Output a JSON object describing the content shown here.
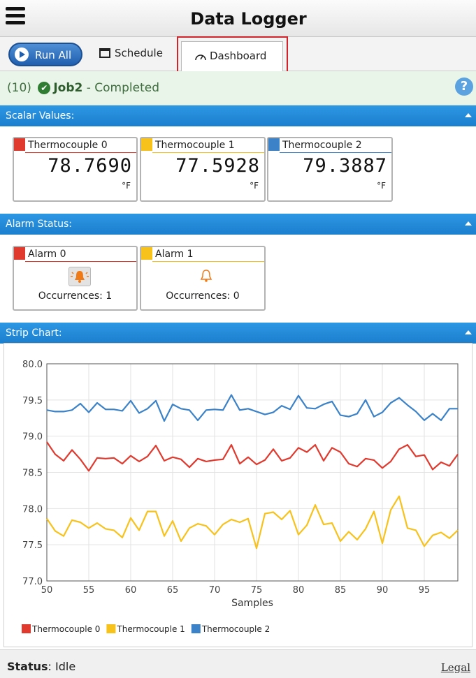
{
  "app": {
    "title": "Data Logger"
  },
  "toolbar": {
    "run_all": "Run All",
    "schedule": "Schedule",
    "dashboard": "Dashboard"
  },
  "job": {
    "count": "(10)",
    "name": "Job2",
    "status": "- Completed",
    "help": "?"
  },
  "sections": {
    "scalar": "Scalar Values:",
    "alarm": "Alarm Status:",
    "strip": "Strip Chart:"
  },
  "scalars": [
    {
      "name": "Thermocouple 0",
      "value": "78.7690",
      "unit": "°F",
      "color": "#e03a2f"
    },
    {
      "name": "Thermocouple 1",
      "value": "77.5928",
      "unit": "°F",
      "color": "#f7c21c"
    },
    {
      "name": "Thermocouple 2",
      "value": "79.3887",
      "unit": "°F",
      "color": "#3b82c8"
    }
  ],
  "alarms": [
    {
      "name": "Alarm 0",
      "occurrences": "Occurrences: 1",
      "color": "#e03a2f",
      "icon": "bell-active-icon"
    },
    {
      "name": "Alarm 1",
      "occurrences": "Occurrences: 0",
      "color": "#f7c21c",
      "icon": "bell-icon"
    }
  ],
  "chart_data": {
    "type": "line",
    "title": "",
    "xlabel": "Samples",
    "ylabel": "",
    "xlim": [
      50,
      99
    ],
    "ylim": [
      77.0,
      80.0
    ],
    "xticks": [
      "50",
      "55",
      "60",
      "65",
      "70",
      "75",
      "80",
      "85",
      "90",
      "95"
    ],
    "yticks": [
      "77.0",
      "77.5",
      "78.0",
      "78.5",
      "79.0",
      "79.5",
      "80.0"
    ],
    "grid": true,
    "legend": "bottom-left",
    "x": [
      50,
      51,
      52,
      53,
      54,
      55,
      56,
      57,
      58,
      59,
      60,
      61,
      62,
      63,
      64,
      65,
      66,
      67,
      68,
      69,
      70,
      71,
      72,
      73,
      74,
      75,
      76,
      77,
      78,
      79,
      80,
      81,
      82,
      83,
      84,
      85,
      86,
      87,
      88,
      89,
      90,
      91,
      92,
      93,
      94,
      95,
      96,
      97,
      98,
      99
    ],
    "series": [
      {
        "name": "Thermocouple 0",
        "color": "#e03a2f",
        "values": [
          78.92,
          78.75,
          78.66,
          78.81,
          78.68,
          78.52,
          78.7,
          78.69,
          78.7,
          78.62,
          78.73,
          78.65,
          78.72,
          78.87,
          78.66,
          78.71,
          78.68,
          78.57,
          78.69,
          78.65,
          78.67,
          78.68,
          78.88,
          78.62,
          78.71,
          78.61,
          78.67,
          78.82,
          78.66,
          78.7,
          78.84,
          78.78,
          78.88,
          78.66,
          78.84,
          78.78,
          78.62,
          78.58,
          78.69,
          78.67,
          78.56,
          78.65,
          78.82,
          78.88,
          78.72,
          78.74,
          78.54,
          78.64,
          78.59,
          78.75
        ]
      },
      {
        "name": "Thermocouple 1",
        "color": "#f7c21c",
        "values": [
          77.86,
          77.69,
          77.62,
          77.84,
          77.81,
          77.73,
          77.8,
          77.72,
          77.7,
          77.6,
          77.87,
          77.7,
          77.96,
          77.96,
          77.62,
          77.83,
          77.55,
          77.73,
          77.79,
          77.76,
          77.64,
          77.78,
          77.85,
          77.81,
          77.86,
          77.45,
          77.93,
          77.95,
          77.85,
          77.97,
          77.64,
          77.77,
          78.05,
          77.78,
          77.8,
          77.55,
          77.68,
          77.57,
          77.72,
          77.96,
          77.52,
          77.98,
          78.17,
          77.73,
          77.7,
          77.48,
          77.63,
          77.67,
          77.59,
          77.7
        ]
      },
      {
        "name": "Thermocouple 2",
        "color": "#3b82c8",
        "values": [
          79.36,
          79.34,
          79.34,
          79.36,
          79.45,
          79.33,
          79.46,
          79.37,
          79.37,
          79.35,
          79.49,
          79.32,
          79.38,
          79.49,
          79.21,
          79.44,
          79.38,
          79.36,
          79.22,
          79.36,
          79.37,
          79.36,
          79.57,
          79.36,
          79.38,
          79.34,
          79.3,
          79.33,
          79.42,
          79.37,
          79.56,
          79.39,
          79.38,
          79.44,
          79.48,
          79.29,
          79.27,
          79.31,
          79.5,
          79.27,
          79.33,
          79.46,
          79.53,
          79.43,
          79.34,
          79.22,
          79.31,
          79.22,
          79.38,
          79.38
        ]
      }
    ]
  },
  "status": {
    "label": "Status",
    "value": "Idle",
    "legal": "Legal"
  }
}
